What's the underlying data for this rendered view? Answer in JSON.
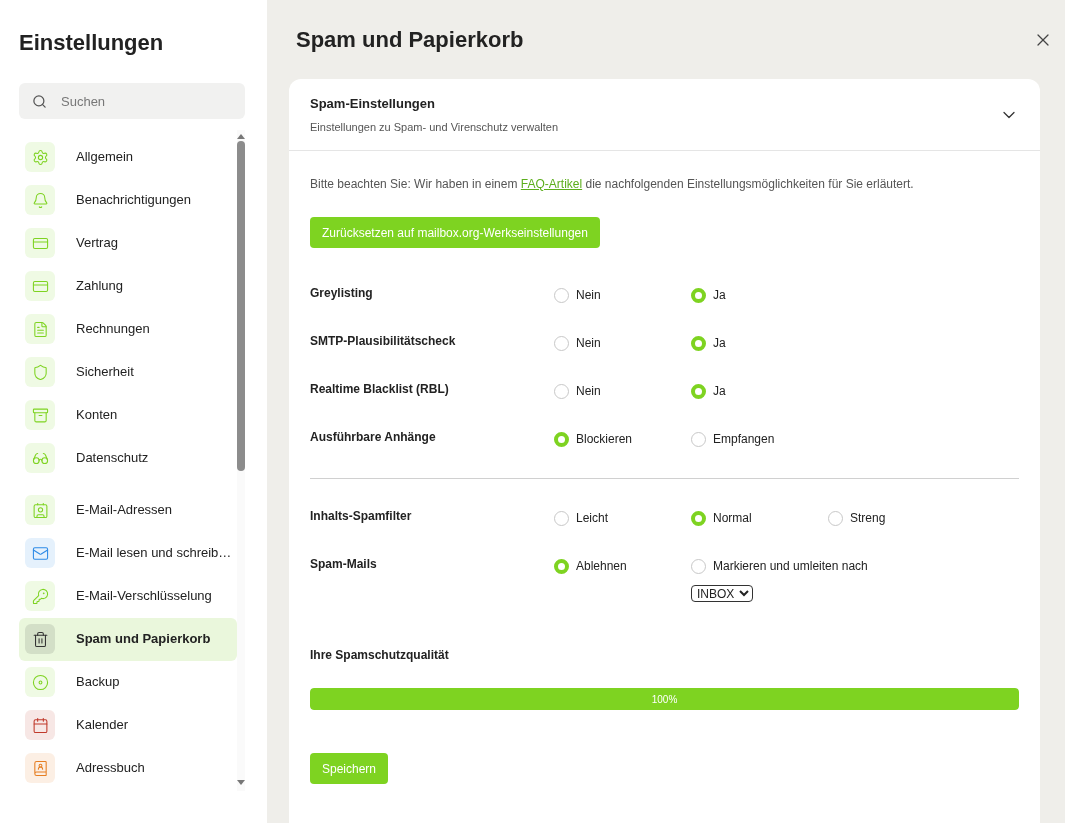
{
  "sidebar": {
    "title": "Einstellungen",
    "search": {
      "placeholder": "Suchen"
    },
    "groups": [
      [
        {
          "label": "Allgemein",
          "selected": false,
          "color": "#7ed321"
        },
        {
          "label": "Benachrichtigungen",
          "selected": false,
          "color": "#7ed321"
        },
        {
          "label": "Vertrag",
          "selected": false,
          "color": "#7ed321"
        },
        {
          "label": "Zahlung",
          "selected": false,
          "color": "#7ed321"
        },
        {
          "label": "Rechnungen",
          "selected": false,
          "color": "#7ed321"
        },
        {
          "label": "Sicherheit",
          "selected": false,
          "color": "#7ed321"
        },
        {
          "label": "Konten",
          "selected": false,
          "color": "#7ed321"
        },
        {
          "label": "Datenschutz",
          "selected": false,
          "color": "#7ed321"
        }
      ],
      [
        {
          "label": "E-Mail-Adressen",
          "selected": false,
          "color": "#7ed321"
        },
        {
          "label": "E-Mail lesen und schreib…",
          "selected": false,
          "color": "#2d8ae6"
        },
        {
          "label": "E-Mail-Verschlüsselung",
          "selected": false,
          "color": "#7ed321"
        },
        {
          "label": "Spam und Papierkorb",
          "selected": true,
          "color": "#333333"
        },
        {
          "label": "Backup",
          "selected": false,
          "color": "#7ed321"
        },
        {
          "label": "Kalender",
          "selected": false,
          "color": "#c0392b"
        },
        {
          "label": "Adressbuch",
          "selected": false,
          "color": "#e67e22"
        }
      ]
    ]
  },
  "page": {
    "title": "Spam und Papierkorb"
  },
  "section": {
    "title": "Spam-Einstellungen",
    "subtitle": "Einstellungen zu Spam- und Virenschutz verwalten",
    "expanded": true,
    "notice": {
      "before": "Bitte beachten Sie: Wir haben in einem ",
      "link": "FAQ-Artikel",
      "after": " die nachfolgenden Einstellungsmöglichkeiten für Sie erläutert."
    },
    "reset_button": "Zurücksetzen auf mailbox.org-Werkseinstellungen",
    "setting_groups": [
      [
        {
          "label": "Greylisting",
          "options": [
            {
              "label": "Nein",
              "selected": false
            },
            {
              "label": "Ja",
              "selected": true
            }
          ]
        },
        {
          "label": "SMTP-Plausibilitätscheck",
          "options": [
            {
              "label": "Nein",
              "selected": false
            },
            {
              "label": "Ja",
              "selected": true
            }
          ]
        },
        {
          "label": "Realtime Blacklist (RBL)",
          "options": [
            {
              "label": "Nein",
              "selected": false
            },
            {
              "label": "Ja",
              "selected": true
            }
          ]
        },
        {
          "label": "Ausführbare Anhänge",
          "options": [
            {
              "label": "Blockieren",
              "selected": true
            },
            {
              "label": "Empfangen",
              "selected": false
            }
          ]
        }
      ],
      [
        {
          "label": "Inhalts-Spamfilter",
          "options": [
            {
              "label": "Leicht",
              "selected": false
            },
            {
              "label": "Normal",
              "selected": true
            },
            {
              "label": "Streng",
              "selected": false
            }
          ]
        },
        {
          "label": "Spam-Mails",
          "options": [
            {
              "label": "Ablehnen",
              "selected": true
            },
            {
              "label": "Markieren und umleiten nach",
              "selected": false,
              "folder": "INBOX"
            }
          ]
        }
      ]
    ],
    "quality": {
      "label": "Ihre Spamschutzqualität",
      "level": 1,
      "reading": "100%"
    },
    "save_button": "Speichern"
  }
}
